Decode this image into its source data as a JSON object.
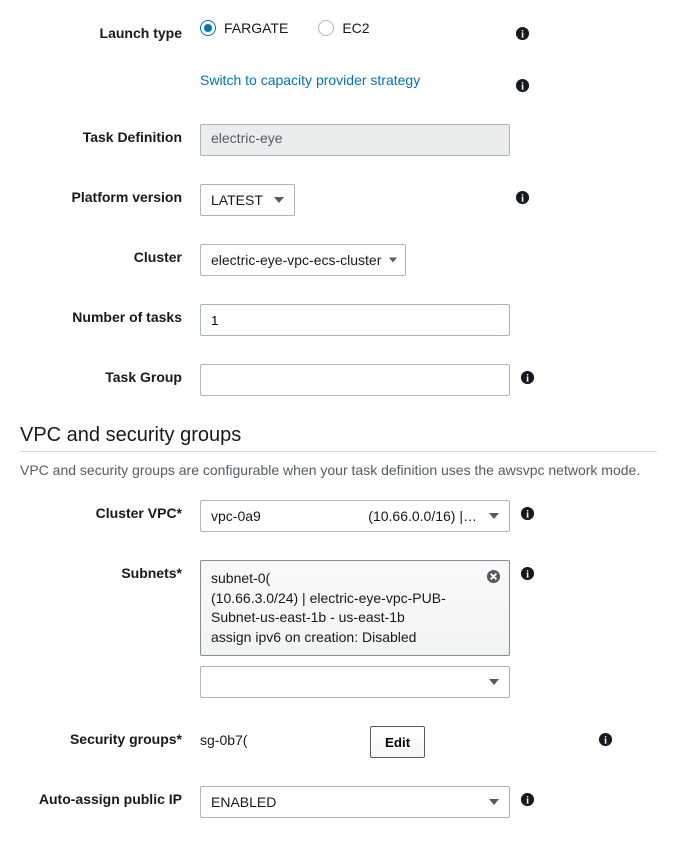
{
  "launch": {
    "label": "Launch type",
    "options": {
      "fargate": "FARGATE",
      "ec2": "EC2"
    },
    "capacity_link": "Switch to capacity provider strategy"
  },
  "task_def": {
    "label": "Task Definition",
    "value": "electric-eye"
  },
  "platform": {
    "label": "Platform version",
    "value": "LATEST"
  },
  "cluster": {
    "label": "Cluster",
    "value": "electric-eye-vpc-ecs-cluster"
  },
  "num_tasks": {
    "label": "Number of tasks",
    "value": "1"
  },
  "task_group": {
    "label": "Task Group",
    "value": ""
  },
  "section_vpc": {
    "title": "VPC and security groups",
    "desc": "VPC and security groups are configurable when your task definition uses the awsvpc network mode."
  },
  "cluster_vpc": {
    "label": "Cluster VPC*",
    "id": "vpc-0a9",
    "cidr_suffix": "(10.66.0.0/16) |…"
  },
  "subnets": {
    "label": "Subnets*",
    "id": "subnet-0(",
    "line2": "(10.66.3.0/24) | electric-eye-vpc-PUB-Subnet-us-east-1b - us-east-1b",
    "line3": "assign ipv6 on creation: Disabled"
  },
  "security_groups": {
    "label": "Security groups*",
    "value": "sg-0b7(",
    "edit": "Edit"
  },
  "public_ip": {
    "label": "Auto-assign public IP",
    "value": "ENABLED"
  }
}
